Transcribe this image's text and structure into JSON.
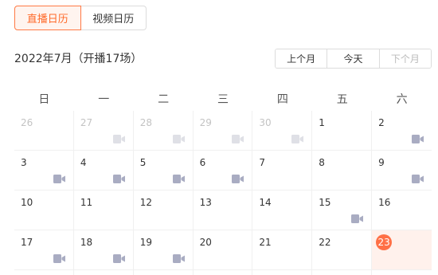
{
  "tabs": [
    {
      "label": "直播日历",
      "active": true
    },
    {
      "label": "视频日历",
      "active": false
    }
  ],
  "month_title": "2022年7月（开播17场）",
  "nav": {
    "prev": "上个月",
    "today": "今天",
    "next": "下个月"
  },
  "weekdays": [
    "日",
    "一",
    "二",
    "三",
    "四",
    "五",
    "六"
  ],
  "days": [
    {
      "day": "26",
      "other": true,
      "video": false
    },
    {
      "day": "27",
      "other": true,
      "video": true
    },
    {
      "day": "28",
      "other": true,
      "video": true
    },
    {
      "day": "29",
      "other": true,
      "video": true
    },
    {
      "day": "30",
      "other": true,
      "video": true
    },
    {
      "day": "1",
      "other": false,
      "video": false
    },
    {
      "day": "2",
      "other": false,
      "video": true
    },
    {
      "day": "3",
      "other": false,
      "video": true
    },
    {
      "day": "4",
      "other": false,
      "video": true
    },
    {
      "day": "5",
      "other": false,
      "video": true
    },
    {
      "day": "6",
      "other": false,
      "video": true
    },
    {
      "day": "7",
      "other": false,
      "video": false
    },
    {
      "day": "8",
      "other": false,
      "video": false
    },
    {
      "day": "9",
      "other": false,
      "video": true
    },
    {
      "day": "10",
      "other": false,
      "video": false
    },
    {
      "day": "11",
      "other": false,
      "video": false
    },
    {
      "day": "12",
      "other": false,
      "video": false
    },
    {
      "day": "13",
      "other": false,
      "video": false
    },
    {
      "day": "14",
      "other": false,
      "video": false
    },
    {
      "day": "15",
      "other": false,
      "video": true
    },
    {
      "day": "16",
      "other": false,
      "video": false
    },
    {
      "day": "17",
      "other": false,
      "video": true
    },
    {
      "day": "18",
      "other": false,
      "video": true
    },
    {
      "day": "19",
      "other": false,
      "video": true
    },
    {
      "day": "20",
      "other": false,
      "video": false
    },
    {
      "day": "21",
      "other": false,
      "video": false
    },
    {
      "day": "22",
      "other": false,
      "video": false
    },
    {
      "day": "23",
      "other": false,
      "video": false,
      "today": true
    }
  ],
  "colors": {
    "accent": "#ff7046",
    "video_icon": "#a9acc2"
  },
  "icons": {
    "video": "video-camera-icon"
  }
}
